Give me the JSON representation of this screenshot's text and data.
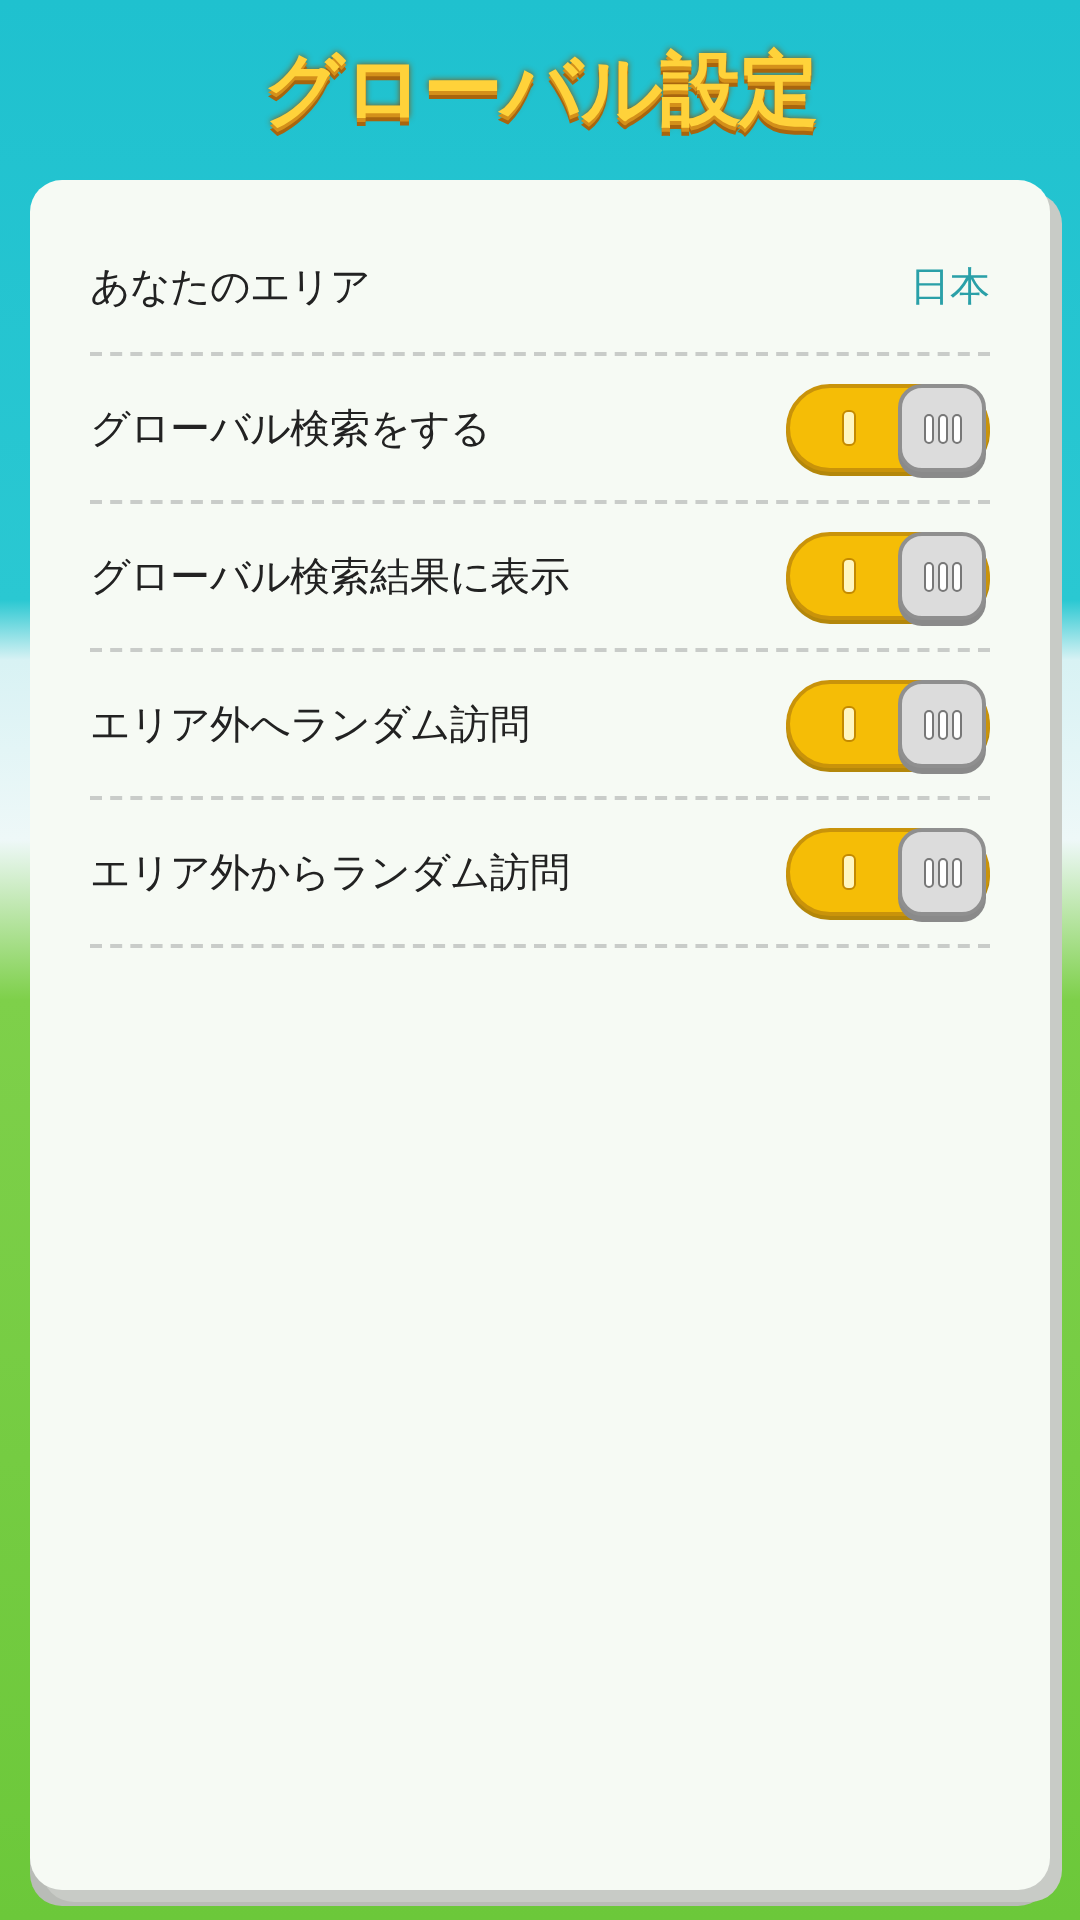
{
  "title": "グローバル設定",
  "area": {
    "label": "あなたのエリア",
    "value": "日本"
  },
  "settings": [
    {
      "label": "グローバル検索をする",
      "on": true
    },
    {
      "label": "グローバル検索結果に表示",
      "on": true
    },
    {
      "label": "エリア外へランダム訪問",
      "on": true
    },
    {
      "label": "エリア外からランダム訪問",
      "on": true
    }
  ]
}
